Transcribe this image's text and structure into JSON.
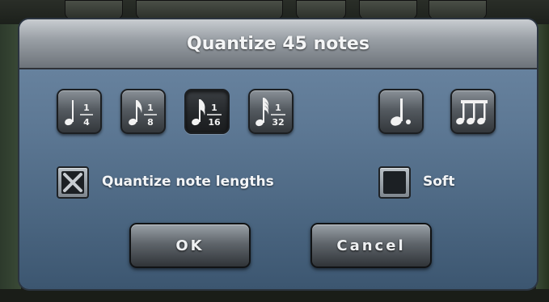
{
  "dialog": {
    "title": "Quantize 45 notes",
    "note_buttons": [
      {
        "icon": "quarter-note-icon",
        "numerator": "1",
        "denominator": "4",
        "selected": false
      },
      {
        "icon": "eighth-note-icon",
        "numerator": "1",
        "denominator": "8",
        "selected": false
      },
      {
        "icon": "sixteenth-note-icon",
        "numerator": "1",
        "denominator": "16",
        "selected": true
      },
      {
        "icon": "thirty-second-note-icon",
        "numerator": "1",
        "denominator": "32",
        "selected": false
      }
    ],
    "dotted_button": {
      "icon": "dotted-note-icon"
    },
    "triplet_button": {
      "icon": "triplet-notes-icon"
    },
    "quantize_lengths": {
      "label": "Quantize note lengths",
      "checked": true
    },
    "soft": {
      "label": "Soft",
      "checked": false
    },
    "ok_label": "OK",
    "cancel_label": "Cancel"
  },
  "colors": {
    "dialog_top": "#6f8aa6",
    "dialog_bottom": "#3c5670",
    "title_text": "#f4f5f6"
  }
}
